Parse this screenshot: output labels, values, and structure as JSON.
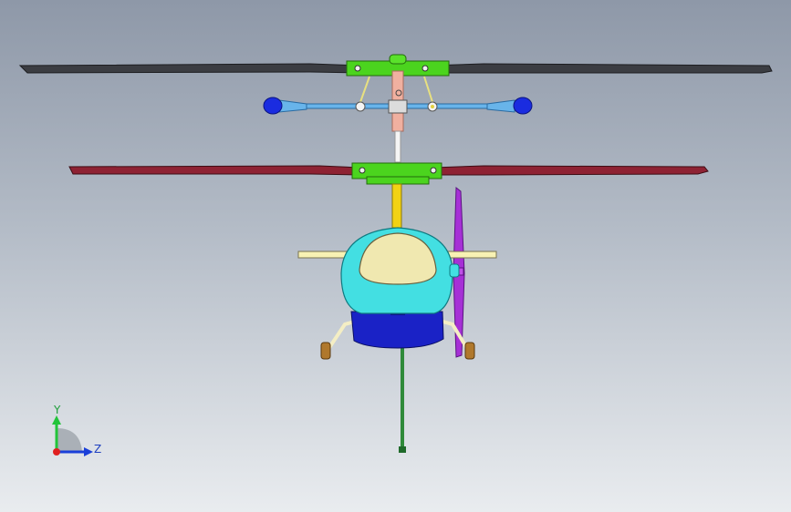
{
  "triad": {
    "y_label": "Y",
    "z_label": "Z",
    "colors": {
      "y": "#22c43a",
      "z": "#1a3fd9",
      "x": "#e02020"
    }
  },
  "palette": {
    "upper_rotor_blade": "#3b3d42",
    "lower_rotor_blade": "#8e2233",
    "rotor_hub": "#4bd41e",
    "flybar": "#68b4ea",
    "flybar_weight": "#1a2ce0",
    "cabin": "#43dfe2",
    "canopy": "#f0e8b0",
    "lower_body": "#1a22c6",
    "mast": "#f2d214",
    "stabilizer": "#f8f2b4",
    "tail_rotor": "#a630d6",
    "skid_strut": "#f4eec4",
    "skid_foot": "#b0782c",
    "tail_boom": "#2f8a3a"
  }
}
